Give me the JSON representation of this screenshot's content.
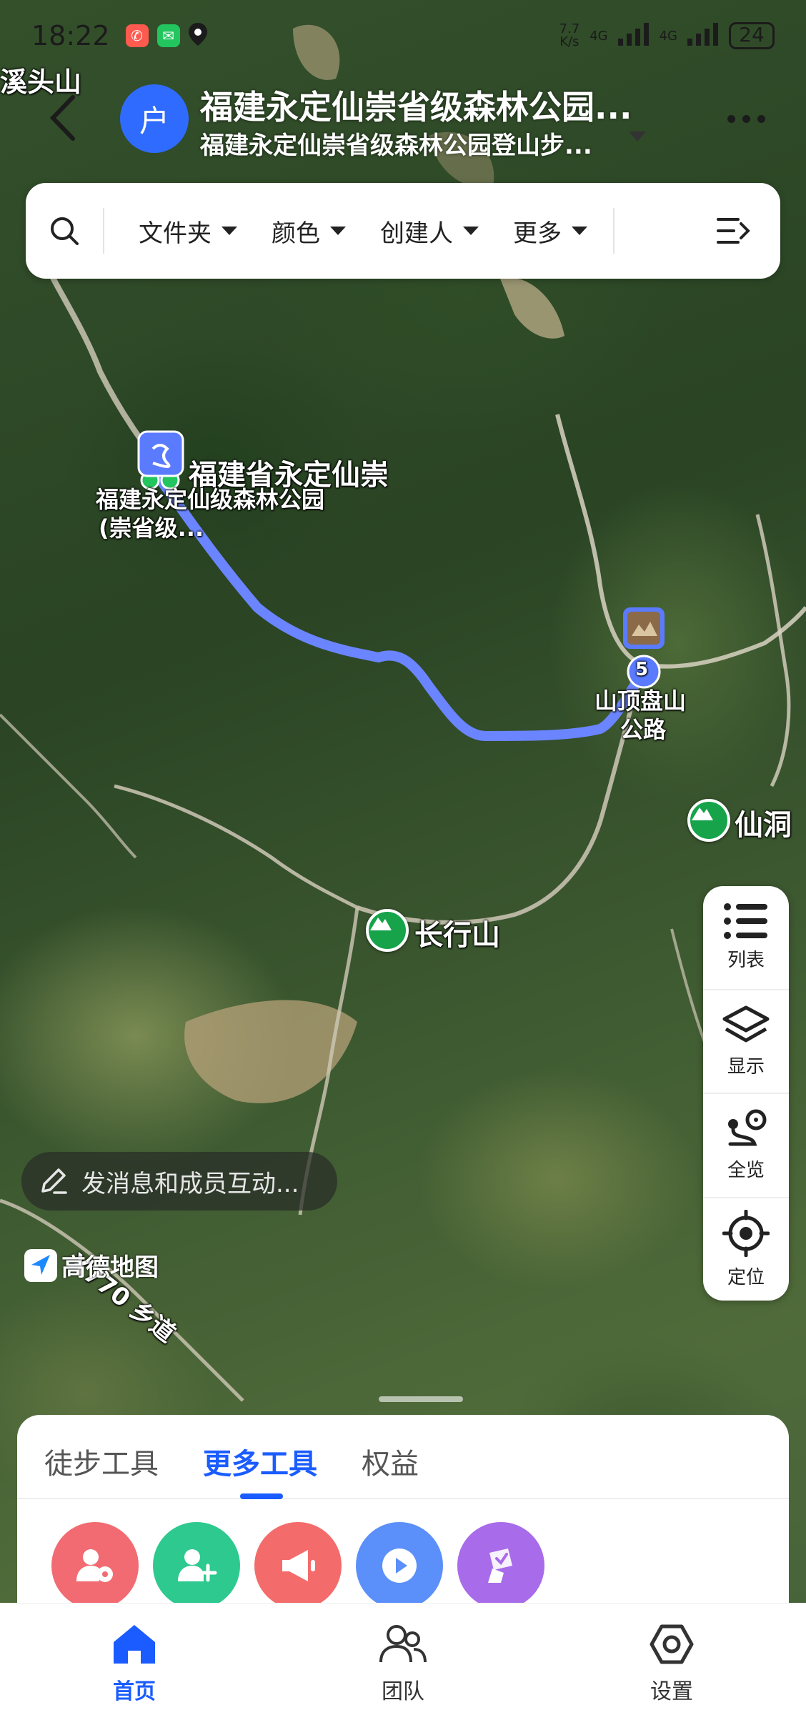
{
  "status_bar": {
    "time": "18:22",
    "speed_value": "7.7",
    "speed_unit": "K/s",
    "net1": "4G",
    "net2": "4G",
    "battery": "24"
  },
  "header": {
    "title": "福建永定仙崇省级森林公园...",
    "subtitle": "福建永定仙崇省级森林公园登山步..."
  },
  "avatar": {
    "text": "户"
  },
  "filters": {
    "items": [
      {
        "label": "文件夹"
      },
      {
        "label": "颜色"
      },
      {
        "label": "创建人"
      },
      {
        "label": "更多"
      }
    ]
  },
  "map": {
    "labels": {
      "top_left_place": "溪头山",
      "start_title": "福建省永定仙崇",
      "start_line1": "福建永定仙级森林公园",
      "start_line2": "(崇省级...",
      "end_line1": "山顶盘山",
      "end_line2": "公路",
      "waypoint_number": "5",
      "peak1": "仙洞",
      "peak2": "长行山",
      "road": "X770 乡道"
    },
    "route_color": "#6a85ff"
  },
  "tool_panel": {
    "items": [
      {
        "label": "列表",
        "icon": "list-icon"
      },
      {
        "label": "显示",
        "icon": "layers-icon"
      },
      {
        "label": "全览",
        "icon": "route-overview-icon"
      },
      {
        "label": "定位",
        "icon": "locate-icon"
      }
    ]
  },
  "message_bar": {
    "placeholder": "发消息和成员互动..."
  },
  "map_brand": {
    "text": "高德地图"
  },
  "sheet": {
    "tabs": [
      {
        "label": "徒步工具",
        "active": false
      },
      {
        "label": "更多工具",
        "active": true
      },
      {
        "label": "权益",
        "active": false
      }
    ],
    "tool_colors": [
      "#f26b72",
      "#2dc98f",
      "#f46b6b",
      "#5b8ff9",
      "#a86bea"
    ]
  },
  "bottom_nav": {
    "items": [
      {
        "label": "首页",
        "active": true
      },
      {
        "label": "团队",
        "active": false
      },
      {
        "label": "设置",
        "active": false
      }
    ]
  },
  "colors": {
    "accent": "#1a5cff"
  }
}
